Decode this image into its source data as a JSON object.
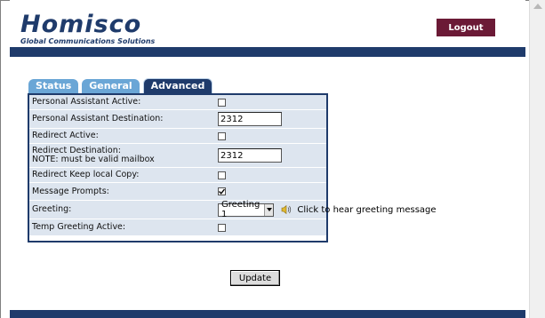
{
  "header": {
    "logo_text": "Homisco",
    "logo_tagline": "Global Communications Solutions",
    "logout_label": "Logout"
  },
  "tabs": [
    {
      "label": "Status",
      "active": false
    },
    {
      "label": "General",
      "active": false
    },
    {
      "label": "Advanced",
      "active": true
    }
  ],
  "form": {
    "rows": [
      {
        "label": "Personal Assistant Active:",
        "type": "checkbox",
        "checked": false
      },
      {
        "label": "Personal Assistant Destination:",
        "type": "text",
        "value": "2312"
      },
      {
        "label": "Redirect Active:",
        "type": "checkbox",
        "checked": false
      },
      {
        "label": "Redirect Destination:",
        "label2": "NOTE: must be valid mailbox",
        "type": "text",
        "value": "2312"
      },
      {
        "label": "Redirect Keep local Copy:",
        "type": "checkbox",
        "checked": false
      },
      {
        "label": "Message Prompts:",
        "type": "checkbox",
        "checked": true
      },
      {
        "label": "Greeting:",
        "type": "select",
        "value": "Greeting 1",
        "hint": "Click to hear greeting message"
      },
      {
        "label": "Temp Greeting Active:",
        "type": "checkbox",
        "checked": false
      }
    ]
  },
  "update_label": "Update",
  "colors": {
    "brand_navy": "#1f3b6b",
    "logout_bg": "#6b1a36",
    "tab_inactive": "#6aa6d6",
    "row_shade": "#dde5ef"
  },
  "icons": {
    "speaker": "speaker-icon",
    "select_arrow": "chevron-down-icon",
    "scroll_up": "scroll-up-arrow-icon"
  }
}
